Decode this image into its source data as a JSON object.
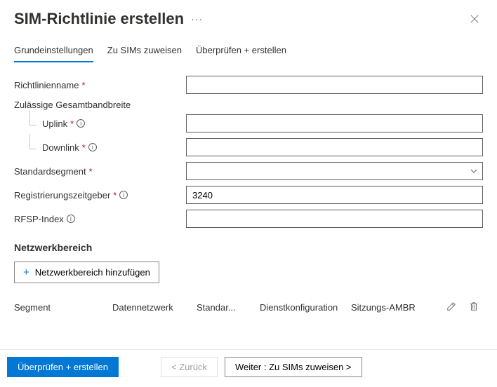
{
  "header": {
    "title": "SIM-Richtlinie erstellen"
  },
  "tabs": [
    {
      "label": "Grundeinstellungen",
      "active": true
    },
    {
      "label": "Zu SIMs zuweisen",
      "active": false
    },
    {
      "label": "Überprüfen + erstellen",
      "active": false
    }
  ],
  "form": {
    "policy_name_label": "Richtlinienname",
    "bandwidth_group_label": "Zulässige Gesamtbandbreite",
    "uplink_label": "Uplink",
    "downlink_label": "Downlink",
    "default_segment_label": "Standardsegment",
    "registration_timer_label": "Registrierungszeitgeber",
    "registration_timer_value": "3240",
    "rfsp_index_label": "RFSP-Index"
  },
  "network_scope": {
    "title": "Netzwerkbereich",
    "add_button": "Netzwerkbereich hinzufügen"
  },
  "table": {
    "columns": {
      "segment": "Segment",
      "data_network": "Datennetzwerk",
      "standard": "Standar...",
      "service_config": "Dienstkonfiguration",
      "session_ambr": "Sitzungs-AMBR"
    }
  },
  "footer": {
    "review_create": "Überprüfen + erstellen",
    "back": "< Zurück",
    "next": "Weiter : Zu SIMs zuweisen  >"
  }
}
